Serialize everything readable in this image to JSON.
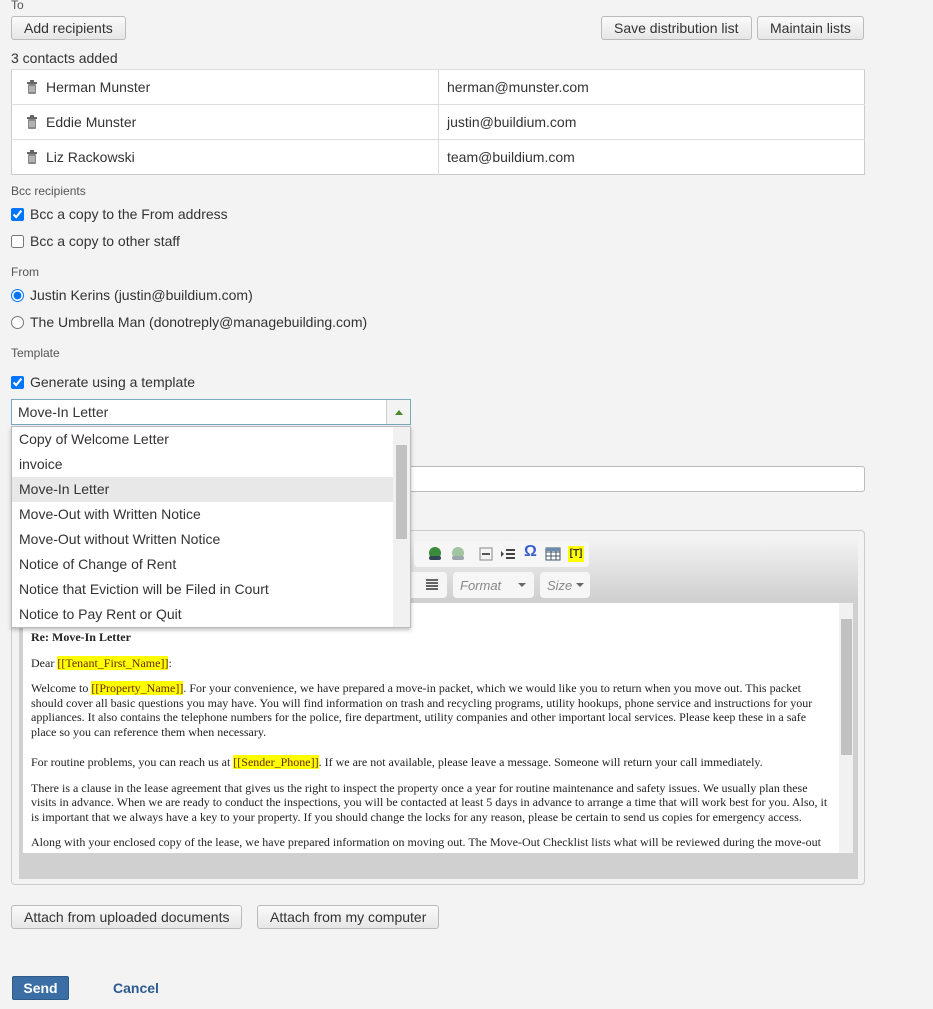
{
  "to": {
    "label": "To",
    "add_recipients": "Add recipients",
    "save_list": "Save distribution list",
    "maintain_lists": "Maintain lists",
    "count": "3 contacts added",
    "contacts": [
      {
        "name": "Herman Munster",
        "email": "herman@munster.com"
      },
      {
        "name": "Eddie Munster",
        "email": "justin@buildium.com"
      },
      {
        "name": "Liz Rackowski",
        "email": "team@buildium.com"
      }
    ]
  },
  "bcc": {
    "label": "Bcc recipients",
    "from_address": "Bcc a copy to the From address",
    "from_checked": true,
    "other_staff": "Bcc a copy to other staff",
    "other_checked": false
  },
  "from": {
    "label": "From",
    "options": [
      "Justin Kerins (justin@buildium.com)",
      "The Umbrella Man (donotreply@managebuilding.com)"
    ],
    "selected": 0
  },
  "template": {
    "label": "Template",
    "generate": "Generate using a template",
    "generate_checked": true,
    "selected": "Move-In Letter",
    "options": [
      "Copy of Welcome Letter",
      "invoice",
      "Move-In Letter",
      "Move-Out with Written Notice",
      "Move-Out without Written Notice",
      "Notice of Change of Rent",
      "Notice that Eviction will be Filed in Court",
      "Notice to Pay Rent or Quit"
    ]
  },
  "editor": {
    "format_placeholder": "Format",
    "size_placeholder": "Size",
    "field_icon_label": "[T]",
    "heading": "Re: Move-In Letter",
    "dear": "Dear ",
    "tenant_field": "[[Tenant_First_Name]]",
    "colon": ":",
    "p1_pre": "Welcome to ",
    "property_field": "[[Property_Name]]",
    "p1_post": ". For your convenience, we have prepared a move-in packet, which we would like you to return when you move out. This packet should cover all basic questions you may have. You will find information on trash and recycling programs, utility hookups, phone service and instructions for your appliances. It also contains the telephone numbers for the police, fire department, utility companies and other important local services. Please keep these in a safe place so you can reference them when necessary.",
    "p2_pre": "For routine problems, you can reach us at ",
    "phone_field": "[[Sender_Phone]]",
    "p2_post": ". If we are not available, please leave a message. Someone will return your call immediately.",
    "p3": "There is a clause in the lease agreement that gives us the right to inspect the property  once  a year for routine maintenance and safety issues. We usually plan these visits in advance. When we are ready to conduct the inspections, you will be contacted at least  5 days  in advance to arrange a time that will work best for you. Also, it is important that we always have a key to your property. If you should change the locks for any reason, please be certain to send us copies for emergency access.",
    "p4": "Along with your enclosed copy of the lease, we have prepared information on moving out. The Move-Out Checklist lists what will be reviewed during the move-out"
  },
  "attach": {
    "uploaded": "Attach from uploaded documents",
    "computer": "Attach from my computer"
  },
  "actions": {
    "send": "Send",
    "cancel": "Cancel"
  },
  "colors": {
    "primary": "#3a6ea5",
    "highlight": "#ffff00",
    "link": "#2d5a90"
  }
}
